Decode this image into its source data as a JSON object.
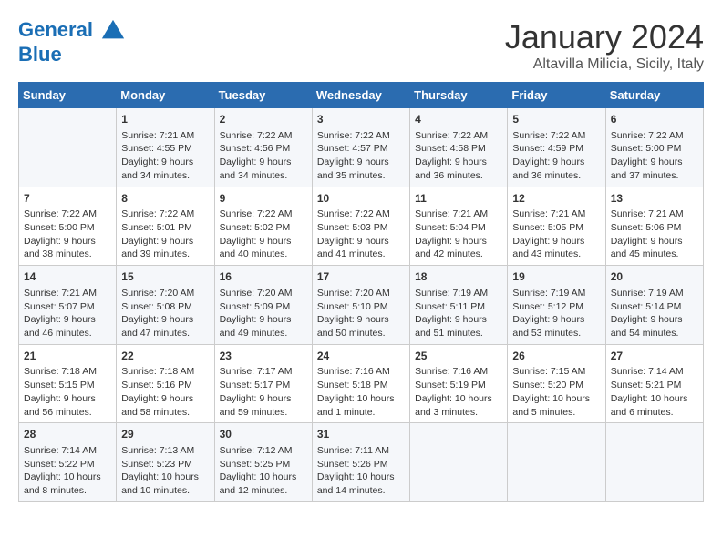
{
  "header": {
    "logo_line1": "General",
    "logo_line2": "Blue",
    "month": "January 2024",
    "location": "Altavilla Milicia, Sicily, Italy"
  },
  "weekdays": [
    "Sunday",
    "Monday",
    "Tuesday",
    "Wednesday",
    "Thursday",
    "Friday",
    "Saturday"
  ],
  "weeks": [
    [
      {
        "day": "",
        "info": ""
      },
      {
        "day": "1",
        "info": "Sunrise: 7:21 AM\nSunset: 4:55 PM\nDaylight: 9 hours\nand 34 minutes."
      },
      {
        "day": "2",
        "info": "Sunrise: 7:22 AM\nSunset: 4:56 PM\nDaylight: 9 hours\nand 34 minutes."
      },
      {
        "day": "3",
        "info": "Sunrise: 7:22 AM\nSunset: 4:57 PM\nDaylight: 9 hours\nand 35 minutes."
      },
      {
        "day": "4",
        "info": "Sunrise: 7:22 AM\nSunset: 4:58 PM\nDaylight: 9 hours\nand 36 minutes."
      },
      {
        "day": "5",
        "info": "Sunrise: 7:22 AM\nSunset: 4:59 PM\nDaylight: 9 hours\nand 36 minutes."
      },
      {
        "day": "6",
        "info": "Sunrise: 7:22 AM\nSunset: 5:00 PM\nDaylight: 9 hours\nand 37 minutes."
      }
    ],
    [
      {
        "day": "7",
        "info": "Sunrise: 7:22 AM\nSunset: 5:00 PM\nDaylight: 9 hours\nand 38 minutes."
      },
      {
        "day": "8",
        "info": "Sunrise: 7:22 AM\nSunset: 5:01 PM\nDaylight: 9 hours\nand 39 minutes."
      },
      {
        "day": "9",
        "info": "Sunrise: 7:22 AM\nSunset: 5:02 PM\nDaylight: 9 hours\nand 40 minutes."
      },
      {
        "day": "10",
        "info": "Sunrise: 7:22 AM\nSunset: 5:03 PM\nDaylight: 9 hours\nand 41 minutes."
      },
      {
        "day": "11",
        "info": "Sunrise: 7:21 AM\nSunset: 5:04 PM\nDaylight: 9 hours\nand 42 minutes."
      },
      {
        "day": "12",
        "info": "Sunrise: 7:21 AM\nSunset: 5:05 PM\nDaylight: 9 hours\nand 43 minutes."
      },
      {
        "day": "13",
        "info": "Sunrise: 7:21 AM\nSunset: 5:06 PM\nDaylight: 9 hours\nand 45 minutes."
      }
    ],
    [
      {
        "day": "14",
        "info": "Sunrise: 7:21 AM\nSunset: 5:07 PM\nDaylight: 9 hours\nand 46 minutes."
      },
      {
        "day": "15",
        "info": "Sunrise: 7:20 AM\nSunset: 5:08 PM\nDaylight: 9 hours\nand 47 minutes."
      },
      {
        "day": "16",
        "info": "Sunrise: 7:20 AM\nSunset: 5:09 PM\nDaylight: 9 hours\nand 49 minutes."
      },
      {
        "day": "17",
        "info": "Sunrise: 7:20 AM\nSunset: 5:10 PM\nDaylight: 9 hours\nand 50 minutes."
      },
      {
        "day": "18",
        "info": "Sunrise: 7:19 AM\nSunset: 5:11 PM\nDaylight: 9 hours\nand 51 minutes."
      },
      {
        "day": "19",
        "info": "Sunrise: 7:19 AM\nSunset: 5:12 PM\nDaylight: 9 hours\nand 53 minutes."
      },
      {
        "day": "20",
        "info": "Sunrise: 7:19 AM\nSunset: 5:14 PM\nDaylight: 9 hours\nand 54 minutes."
      }
    ],
    [
      {
        "day": "21",
        "info": "Sunrise: 7:18 AM\nSunset: 5:15 PM\nDaylight: 9 hours\nand 56 minutes."
      },
      {
        "day": "22",
        "info": "Sunrise: 7:18 AM\nSunset: 5:16 PM\nDaylight: 9 hours\nand 58 minutes."
      },
      {
        "day": "23",
        "info": "Sunrise: 7:17 AM\nSunset: 5:17 PM\nDaylight: 9 hours\nand 59 minutes."
      },
      {
        "day": "24",
        "info": "Sunrise: 7:16 AM\nSunset: 5:18 PM\nDaylight: 10 hours\nand 1 minute."
      },
      {
        "day": "25",
        "info": "Sunrise: 7:16 AM\nSunset: 5:19 PM\nDaylight: 10 hours\nand 3 minutes."
      },
      {
        "day": "26",
        "info": "Sunrise: 7:15 AM\nSunset: 5:20 PM\nDaylight: 10 hours\nand 5 minutes."
      },
      {
        "day": "27",
        "info": "Sunrise: 7:14 AM\nSunset: 5:21 PM\nDaylight: 10 hours\nand 6 minutes."
      }
    ],
    [
      {
        "day": "28",
        "info": "Sunrise: 7:14 AM\nSunset: 5:22 PM\nDaylight: 10 hours\nand 8 minutes."
      },
      {
        "day": "29",
        "info": "Sunrise: 7:13 AM\nSunset: 5:23 PM\nDaylight: 10 hours\nand 10 minutes."
      },
      {
        "day": "30",
        "info": "Sunrise: 7:12 AM\nSunset: 5:25 PM\nDaylight: 10 hours\nand 12 minutes."
      },
      {
        "day": "31",
        "info": "Sunrise: 7:11 AM\nSunset: 5:26 PM\nDaylight: 10 hours\nand 14 minutes."
      },
      {
        "day": "",
        "info": ""
      },
      {
        "day": "",
        "info": ""
      },
      {
        "day": "",
        "info": ""
      }
    ]
  ]
}
